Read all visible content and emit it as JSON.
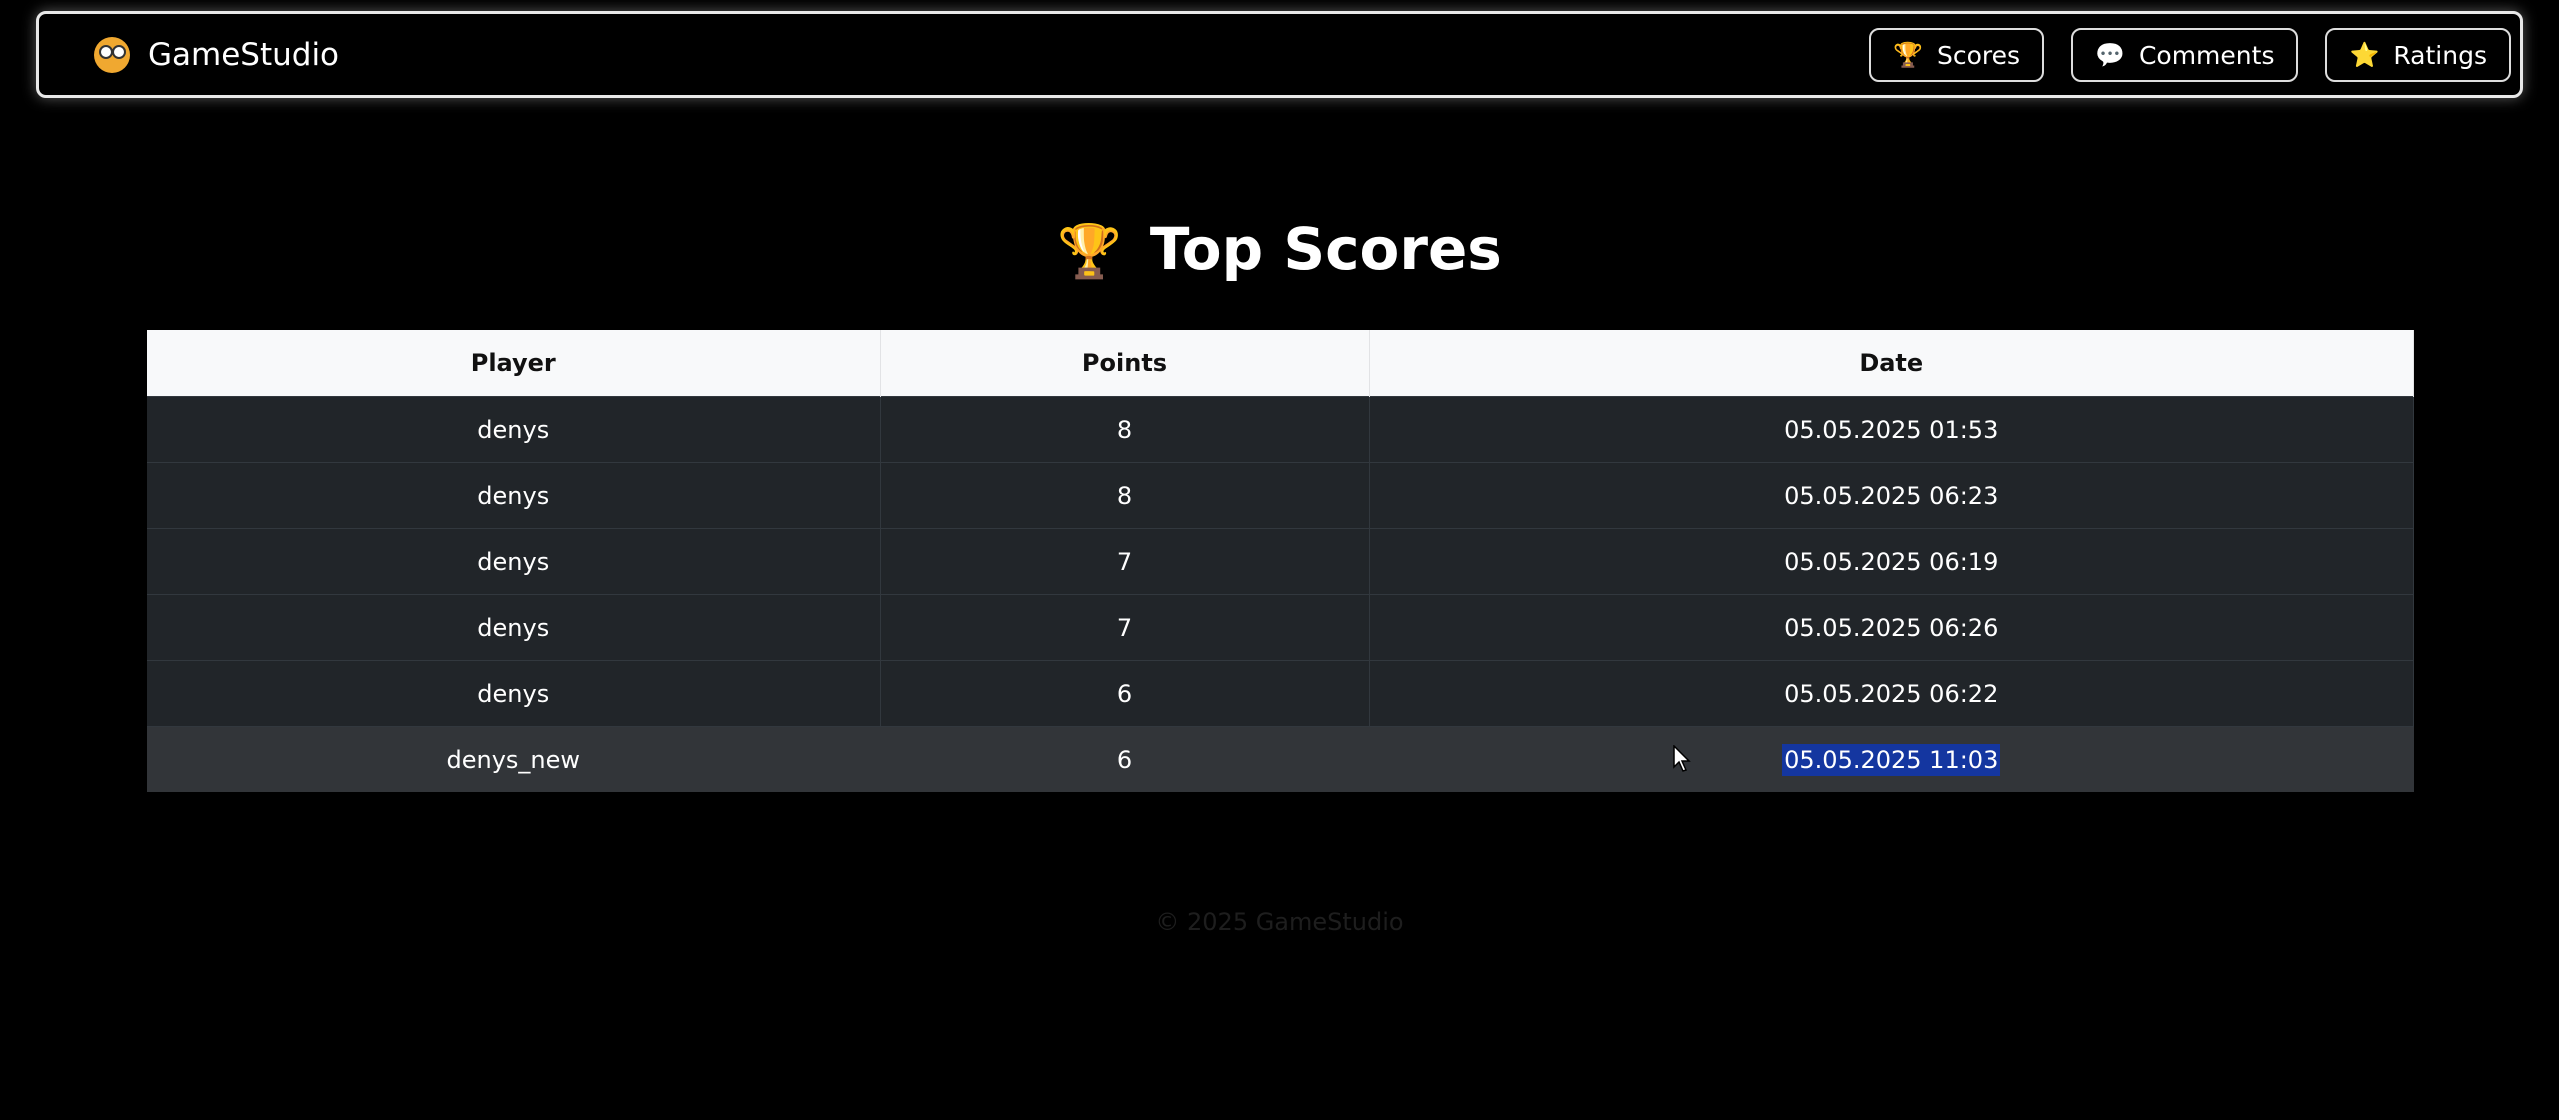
{
  "navbar": {
    "brand": "GameStudio",
    "brand_icon": "face-emoji-icon",
    "buttons": [
      {
        "label": "Scores",
        "icon": "🏆"
      },
      {
        "label": "Comments",
        "icon": "💬"
      },
      {
        "label": "Ratings",
        "icon": "⭐"
      }
    ]
  },
  "page": {
    "title": "Top Scores",
    "title_icon": "🏆"
  },
  "table": {
    "headers": [
      "Player",
      "Points",
      "Date"
    ],
    "rows": [
      [
        "denys",
        "8",
        "05.05.2025 01:53"
      ],
      [
        "denys",
        "8",
        "05.05.2025 06:23"
      ],
      [
        "denys",
        "7",
        "05.05.2025 06:19"
      ],
      [
        "denys",
        "7",
        "05.05.2025 06:26"
      ],
      [
        "denys",
        "6",
        "05.05.2025 06:22"
      ],
      [
        "denys_new",
        "6",
        "05.05.2025 11:03"
      ]
    ]
  },
  "footer": {
    "text": "© 2025 GameStudio"
  }
}
